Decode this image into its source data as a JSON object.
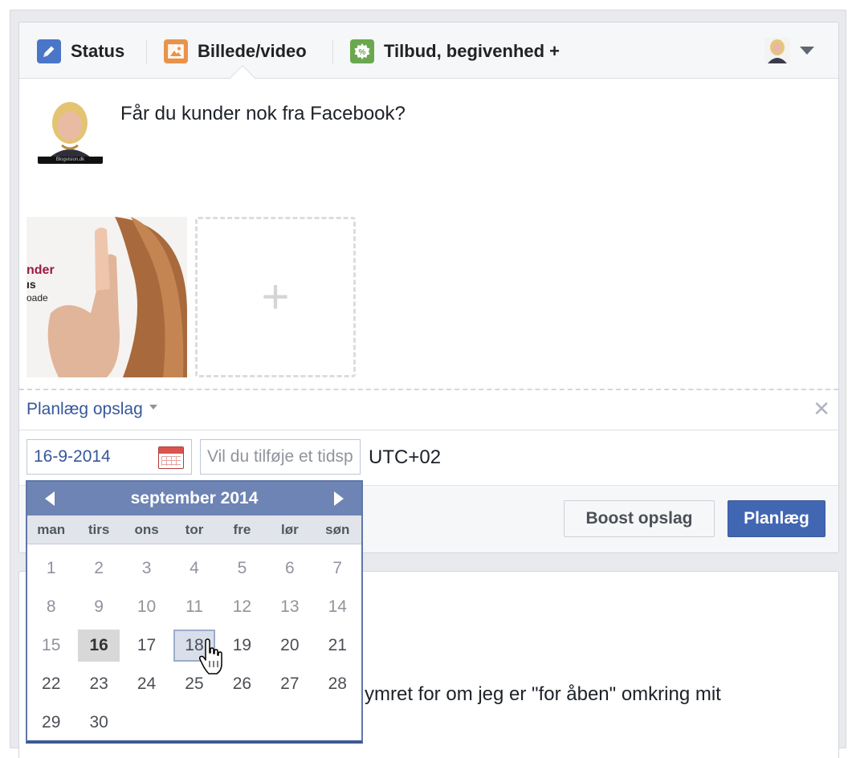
{
  "composer": {
    "tabs": [
      {
        "label": "Status",
        "icon": "pencil-icon",
        "color": "#4a76c8"
      },
      {
        "label": "Billede/video",
        "icon": "photo-icon",
        "color": "#e8934c"
      },
      {
        "label": "Tilbud, begivenhed +",
        "icon": "offer-icon",
        "color": "#6aa84f"
      }
    ],
    "post_text": "Får du kunder nok fra Facebook?",
    "avatar_caption": "Blogvision.dk",
    "thumbnail_text": [
      "nder",
      "ıs",
      "oade"
    ],
    "schedule_label": "Planlæg opslag",
    "close_glyph": "✕",
    "date_value": "16-9-2014",
    "time_placeholder": "Vil du tilføje et tidspunkt?",
    "timezone": "UTC+02",
    "boost_label": "Boost opslag",
    "plan_label": "Planlæg"
  },
  "card2": {
    "text": "ymret for om jeg er \"for åben\" omkring mit"
  },
  "calendar": {
    "month_label": "september 2014",
    "weekdays": [
      "man",
      "tirs",
      "ons",
      "tor",
      "fre",
      "lør",
      "søn"
    ],
    "days": [
      "1",
      "2",
      "3",
      "4",
      "5",
      "6",
      "7",
      "8",
      "9",
      "10",
      "11",
      "12",
      "13",
      "14",
      "15",
      "16",
      "17",
      "18",
      "19",
      "20",
      "21",
      "22",
      "23",
      "24",
      "25",
      "26",
      "27",
      "28",
      "29",
      "30"
    ],
    "selected_day": "16",
    "hover_day": "18",
    "past_days_through": "15"
  },
  "colors": {
    "accent": "#4267b2",
    "link": "#365899",
    "calendar_header": "#6d84b4"
  }
}
